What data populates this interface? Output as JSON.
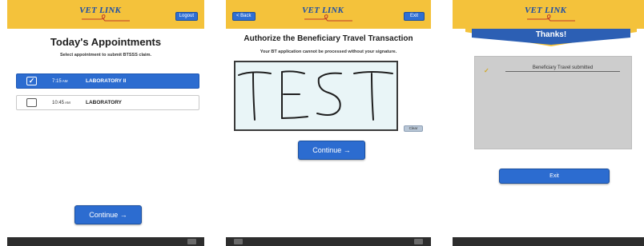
{
  "brand": {
    "logo_text": "VET",
    "logo_text2": "LINK",
    "yellow": "#f4c23b",
    "blue": "#2c6cd0"
  },
  "screen1": {
    "top_button": "Logout",
    "title": "Today's Appointments",
    "subtitle": "Select appointment to submit BTSSS claim.",
    "appointments": [
      {
        "time": "7:15",
        "ampm": "AM",
        "name": "LABORATORY II",
        "selected": true,
        "check": "✓"
      },
      {
        "time": "10:45",
        "ampm": "AM",
        "name": "LABORATORY",
        "selected": false,
        "check": ""
      }
    ],
    "continue_label": "Continue →"
  },
  "screen2": {
    "back_button": "< Back",
    "exit_button": "Exit",
    "title": "Authorize the Beneficiary Travel Transaction",
    "subtitle": "Your BT application cannot be processed without your signature.",
    "signature_text": "TEST",
    "clear_label": "Clear",
    "continue_label": "Continue →"
  },
  "screen3": {
    "banner_title": "Thanks!",
    "check_icon": "check-icon",
    "status_text": "Beneficiary Travel submitted",
    "exit_label": "Exit"
  }
}
